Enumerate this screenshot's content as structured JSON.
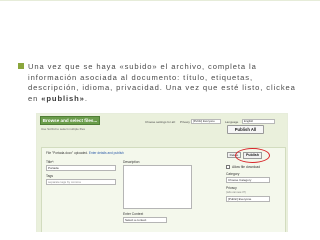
{
  "slide": {
    "bullet_text": "Una vez que se haya «subido» el archivo, completa la información asociada al documento: título, etiquetas, descripción, idioma, privacidad. Una vez que esté listo, clickea en ",
    "bullet_emphasis": "«publish»",
    "bullet_end": ".",
    "accent_color": "#8aa63c"
  },
  "screenshot": {
    "browse_button": "Browse and select files...",
    "upload_help": "Use Scribd to select multiple files",
    "settings_label": "Choose settings for all:",
    "privacy_label": "Privacy",
    "privacy_value": "[Public] Everyone",
    "language_label": "Language",
    "language_value": "English",
    "publish_all": "Publish All",
    "uploaded_prefix": "File \"Portada.docx\" uploaded.",
    "uploaded_link": "Enter details and publish",
    "title_label": "Title*:",
    "title_value": "Portada",
    "description_label": "Description",
    "tags_label": "Tags",
    "tags_placeholder": "separate tags by comma",
    "delete_button": "Delete",
    "publish_button": "Publish",
    "allow_download_label": "Allow file download",
    "category_label": "Category",
    "category_value": "Choose Category",
    "privacy_field_label": "Privacy",
    "privacy_hint": "(who can see it?)",
    "privacy_field_value": "[Public] Everyone",
    "context_label": "Enter Context",
    "context_value": "Select a context",
    "highlight_color": "#d8262a"
  }
}
